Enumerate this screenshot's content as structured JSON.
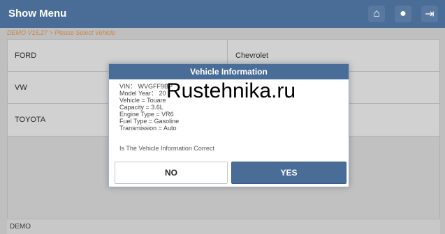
{
  "app": {
    "title": "Show Menu",
    "crumb": "DEMO V15.27 > Please Select  Vehicle",
    "footer": "DEMO"
  },
  "header": {
    "icons": [
      {
        "name": "home-icon",
        "glyph": "⌂"
      },
      {
        "name": "print-icon",
        "glyph": "●"
      },
      {
        "name": "exit-icon",
        "glyph": "⇥"
      }
    ]
  },
  "list": {
    "left": [
      "FORD",
      "VW",
      "TOYOTA"
    ],
    "right": [
      "Chevrolet",
      "",
      ""
    ]
  },
  "dialog": {
    "title": "Vehicle Information",
    "lines": [
      "VIN： WVGFF9BP",
      "Model Year： 20",
      "Vehicle = Touare",
      "Capacity = 3.6L",
      "Engine Type = VR6",
      "Fuel Type = Gasoline",
      "Transmission = Auto"
    ],
    "question": "Is The Vehicle Information Correct",
    "no_label": "NO",
    "yes_label": "YES"
  },
  "watermark": "Rustehnika.ru",
  "colors": {
    "accent": "#4a6d97",
    "crumb": "#f5a25a"
  }
}
